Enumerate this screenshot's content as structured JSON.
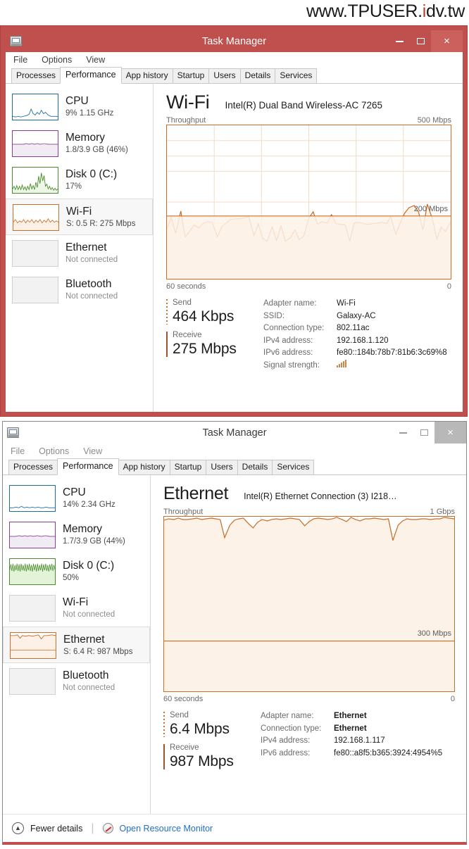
{
  "watermark": {
    "pre": "www.TPUSER.",
    "accent": "i",
    "post": "dv.tw"
  },
  "windows": [
    {
      "id": "wifi-window",
      "title": "Task Manager",
      "state": "active",
      "titlebar_buttons": {
        "minimize": "–",
        "maximize": "□",
        "close": "×"
      },
      "menu": [
        "File",
        "Options",
        "View"
      ],
      "tabs": [
        {
          "label": "Processes",
          "selected": false
        },
        {
          "label": "Performance",
          "selected": true
        },
        {
          "label": "App history",
          "selected": false
        },
        {
          "label": "Startup",
          "selected": false
        },
        {
          "label": "Users",
          "selected": false
        },
        {
          "label": "Details",
          "selected": false
        },
        {
          "label": "Services",
          "selected": false
        }
      ],
      "sidebar": [
        {
          "name": "CPU",
          "sub": "9%  1.15 GHz",
          "connected": true,
          "selected": false,
          "color": "#1f6d9e",
          "fill": "#e9f2f8"
        },
        {
          "name": "Memory",
          "sub": "1.8/3.9 GB (46%)",
          "connected": true,
          "selected": false,
          "color": "#8b3d99",
          "fill": "#f2ecf4"
        },
        {
          "name": "Disk 0 (C:)",
          "sub": "17%",
          "connected": true,
          "selected": false,
          "color": "#4a8b2c",
          "fill": "#eef6e8"
        },
        {
          "name": "Wi-Fi",
          "sub": "S: 0.5 R: 275 Mbps",
          "connected": true,
          "selected": true,
          "color": "#c8702a",
          "fill": "#fdf0e6"
        },
        {
          "name": "Ethernet",
          "sub": "Not connected",
          "connected": false,
          "selected": false,
          "color": "#c8702a",
          "fill": "#fdf0e6"
        },
        {
          "name": "Bluetooth",
          "sub": "Not connected",
          "connected": false,
          "selected": false,
          "color": "#c8702a",
          "fill": "#fdf0e6"
        }
      ],
      "main": {
        "title": "Wi-Fi",
        "adapter": "Intel(R) Dual Band Wireless-AC 7265",
        "chart_caption": "Throughput",
        "y_max_label": "500 Mbps",
        "inner_label": "200 Mbps",
        "x_left_label": "60 seconds",
        "x_right_label": "0"
      },
      "stats": [
        {
          "label": "Send",
          "value": "464 Kbps",
          "marker": "dotted"
        },
        {
          "label": "Receive",
          "value": "275 Mbps",
          "marker": "solid"
        }
      ],
      "info": [
        {
          "key": "Adapter name:",
          "value": "Wi-Fi",
          "bold": false
        },
        {
          "key": "SSID:",
          "value": "Galaxy-AC",
          "bold": false
        },
        {
          "key": "Connection type:",
          "value": "802.11ac",
          "bold": false
        },
        {
          "key": "IPv4 address:",
          "value": "192.168.1.120",
          "bold": false
        },
        {
          "key": "IPv6 address:",
          "value": "fe80::184b:78b7:81b6:3c69%8",
          "bold": false
        },
        {
          "key": "Signal strength:",
          "value": "",
          "bold": false,
          "icon": "signal-bars",
          "bars": 5
        }
      ],
      "footer": null
    },
    {
      "id": "ethernet-window",
      "title": "Task Manager",
      "state": "inactive",
      "titlebar_buttons": {
        "minimize": "–",
        "maximize": "□",
        "close": "×"
      },
      "menu": [
        "File",
        "Options",
        "View"
      ],
      "tabs": [
        {
          "label": "Processes",
          "selected": false
        },
        {
          "label": "Performance",
          "selected": true
        },
        {
          "label": "App history",
          "selected": false
        },
        {
          "label": "Startup",
          "selected": false
        },
        {
          "label": "Users",
          "selected": false
        },
        {
          "label": "Details",
          "selected": false
        },
        {
          "label": "Services",
          "selected": false
        }
      ],
      "sidebar": [
        {
          "name": "CPU",
          "sub": "14%  2.34 GHz",
          "connected": true,
          "selected": false,
          "color": "#1f6d9e",
          "fill": "#e9f2f8"
        },
        {
          "name": "Memory",
          "sub": "1.7/3.9 GB (44%)",
          "connected": true,
          "selected": false,
          "color": "#8b3d99",
          "fill": "#f2ecf4"
        },
        {
          "name": "Disk 0 (C:)",
          "sub": "50%",
          "connected": true,
          "selected": false,
          "color": "#4a8b2c",
          "fill": "#e3f3d8"
        },
        {
          "name": "Wi-Fi",
          "sub": "Not connected",
          "connected": false,
          "selected": false,
          "color": "#c8702a",
          "fill": "#fdf0e6"
        },
        {
          "name": "Ethernet",
          "sub": "S: 6.4 R: 987 Mbps",
          "connected": true,
          "selected": true,
          "color": "#c8702a",
          "fill": "#fdf0e6"
        },
        {
          "name": "Bluetooth",
          "sub": "Not connected",
          "connected": false,
          "selected": false,
          "color": "#c8702a",
          "fill": "#fdf0e6"
        }
      ],
      "main": {
        "title": "Ethernet",
        "adapter": "Intel(R) Ethernet Connection (3) I218…",
        "chart_caption": "Throughput",
        "y_max_label": "1 Gbps",
        "inner_label": "300 Mbps",
        "x_left_label": "60 seconds",
        "x_right_label": "0"
      },
      "stats": [
        {
          "label": "Send",
          "value": "6.4 Mbps",
          "marker": "dotted"
        },
        {
          "label": "Receive",
          "value": "987 Mbps",
          "marker": "solid"
        }
      ],
      "info": [
        {
          "key": "Adapter name:",
          "value": "Ethernet",
          "bold": true
        },
        {
          "key": "Connection type:",
          "value": "Ethernet",
          "bold": true
        },
        {
          "key": "IPv4 address:",
          "value": "192.168.1.117",
          "bold": false
        },
        {
          "key": "IPv6 address:",
          "value": "fe80::a8f5:b365:3924:4954%5",
          "bold": false
        }
      ],
      "footer": {
        "fewer_details": "Fewer details",
        "resource_monitor": "Open Resource Monitor"
      }
    }
  ],
  "chart_data": [
    {
      "type": "area",
      "title": "Wi-Fi Throughput",
      "ylabel": "Throughput",
      "xlabel": "60 seconds",
      "ylim": [
        0,
        500
      ],
      "y_unit": "Mbps",
      "y_max_label": "500 Mbps",
      "reference_line": {
        "value": 200,
        "label": "200 Mbps"
      },
      "x_tick_labels": [
        "60 seconds",
        "0"
      ],
      "grid": true,
      "legend": "none",
      "series_color": "#c8702a",
      "series": [
        {
          "name": "Receive throughput",
          "values": [
            168,
            150,
            215,
            145,
            130,
            172,
            160,
            166,
            185,
            190,
            188,
            125,
            162,
            174,
            186,
            188,
            188,
            192,
            196,
            155,
            180,
            140,
            132,
            172,
            135,
            174,
            130,
            140,
            165,
            142,
            148,
            198,
            215,
            178,
            185,
            182,
            206,
            180,
            178,
            175,
            130,
            184,
            186,
            182,
            178,
            180,
            184,
            180,
            196,
            155,
            184,
            200,
            218,
            224,
            206,
            160,
            228,
            196,
            140,
            170,
            160,
            186
          ]
        }
      ]
    },
    {
      "type": "area",
      "title": "Ethernet Throughput",
      "ylabel": "Throughput",
      "xlabel": "60 seconds",
      "ylim": [
        0,
        1000
      ],
      "y_unit": "Mbps",
      "y_max_label": "1 Gbps",
      "reference_line": {
        "value": 300,
        "label": "300 Mbps"
      },
      "x_tick_labels": [
        "60 seconds",
        "0"
      ],
      "grid": true,
      "legend": "none",
      "series_color": "#c8702a",
      "series": [
        {
          "name": "Receive throughput",
          "values": [
            980,
            988,
            985,
            990,
            986,
            982,
            988,
            990,
            984,
            986,
            992,
            988,
            986,
            700,
            900,
            970,
            988,
            990,
            960,
            935,
            970,
            980,
            975,
            982,
            988,
            984,
            986,
            990,
            986,
            982,
            948,
            972,
            988,
            990,
            986,
            984,
            988,
            992,
            984,
            974,
            994,
            984,
            978,
            986,
            988,
            990,
            986,
            982,
            986,
            664,
            900,
            965,
            988,
            984,
            982,
            986,
            988,
            984,
            986,
            988,
            996,
            986
          ]
        }
      ]
    }
  ]
}
